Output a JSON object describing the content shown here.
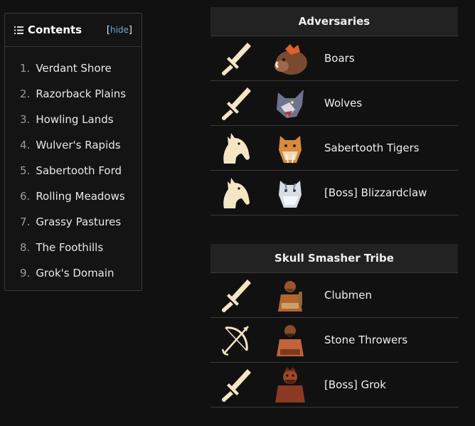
{
  "toc": {
    "title": "Contents",
    "toggle_open": "[",
    "toggle_label": "hide",
    "toggle_close": "]",
    "items": [
      {
        "num": "1.",
        "label": "Verdant Shore"
      },
      {
        "num": "2.",
        "label": "Razorback Plains"
      },
      {
        "num": "3.",
        "label": "Howling Lands"
      },
      {
        "num": "4.",
        "label": "Wulver's Rapids"
      },
      {
        "num": "5.",
        "label": "Sabertooth Ford"
      },
      {
        "num": "6.",
        "label": "Rolling Meadows"
      },
      {
        "num": "7.",
        "label": "Grassy Pastures"
      },
      {
        "num": "8.",
        "label": "The Foothills"
      },
      {
        "num": "9.",
        "label": "Grok's Domain"
      }
    ]
  },
  "adversaries": {
    "title": "Adversaries",
    "rows": [
      {
        "type_icon": "sword-icon",
        "portrait": "boar-portrait",
        "name": "Boars"
      },
      {
        "type_icon": "sword-icon",
        "portrait": "wolf-portrait",
        "name": "Wolves"
      },
      {
        "type_icon": "horse-icon",
        "portrait": "sabertooth-tiger-portrait",
        "name": "Sabertooth Tigers"
      },
      {
        "type_icon": "horse-icon",
        "portrait": "white-tiger-portrait",
        "name": "[Boss] Blizzardclaw"
      }
    ]
  },
  "tribe": {
    "title": "Skull Smasher Tribe",
    "rows": [
      {
        "type_icon": "sword-icon",
        "portrait": "clubman-portrait",
        "name": "Clubmen"
      },
      {
        "type_icon": "bow-icon",
        "portrait": "stone-thrower-portrait",
        "name": "Stone Throwers"
      },
      {
        "type_icon": "sword-icon",
        "portrait": "grok-portrait",
        "name": "[Boss] Grok"
      }
    ]
  },
  "colors": {
    "background": "#111111",
    "header_bg": "#222222",
    "link": "#6fa8dc",
    "icon_cream": "#f4e6c4"
  }
}
